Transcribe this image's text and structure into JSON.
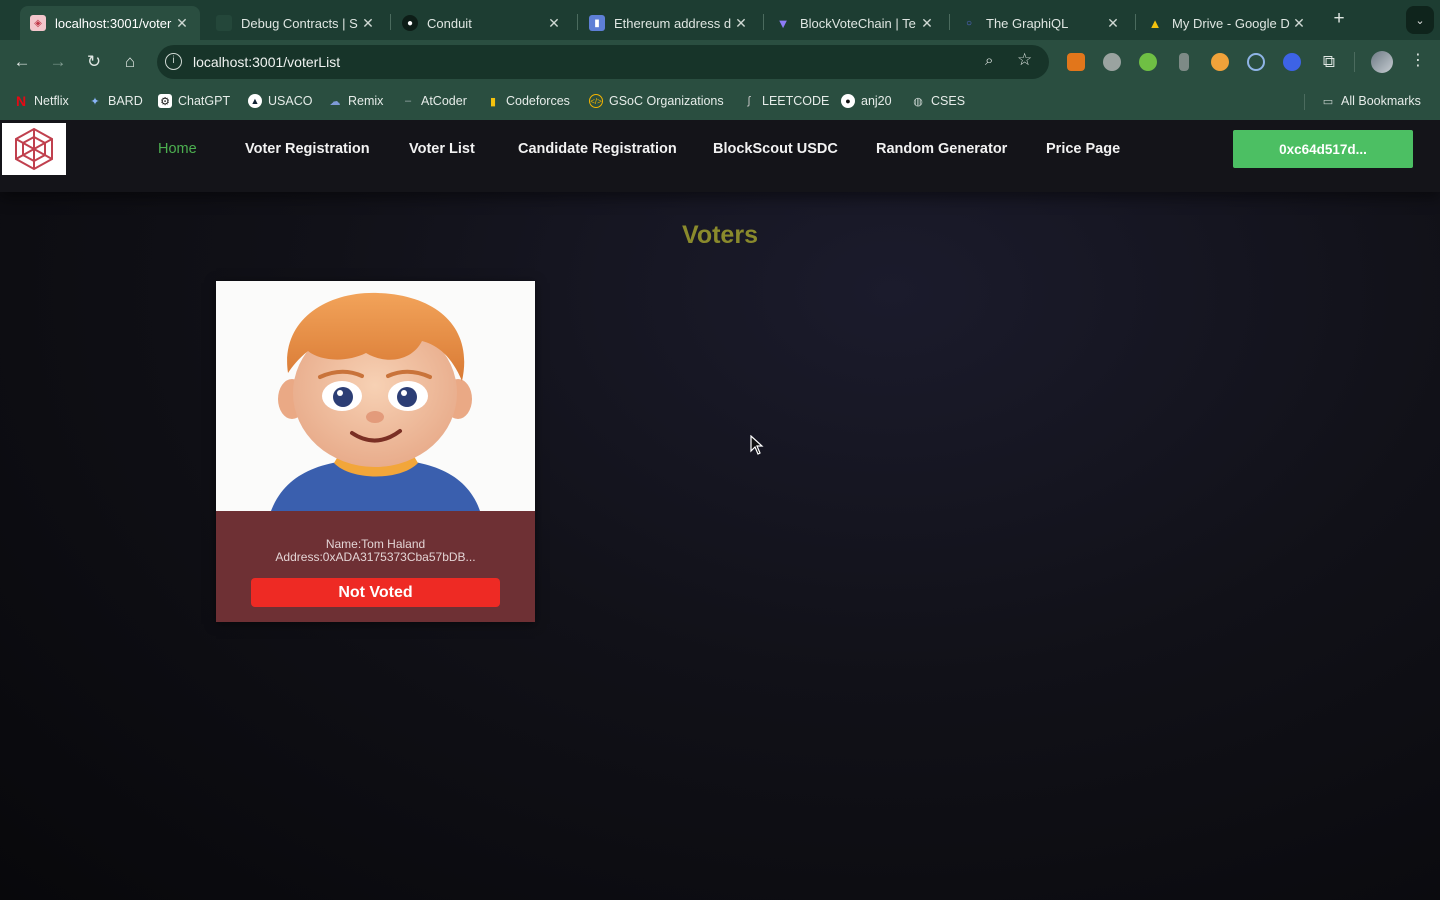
{
  "browser": {
    "tabs": [
      {
        "label": "localhost:3001/voter",
        "active": true,
        "closable": true
      },
      {
        "label": "Debug Contracts | S",
        "active": false,
        "closable": true
      },
      {
        "label": "Conduit",
        "active": false,
        "closable": true
      },
      {
        "label": "Ethereum address d",
        "active": false,
        "closable": true
      },
      {
        "label": "BlockVoteChain | Te",
        "active": false,
        "closable": true
      },
      {
        "label": "The GraphiQL",
        "active": false,
        "closable": true
      },
      {
        "label": "My Drive - Google D",
        "active": false,
        "closable": true
      }
    ],
    "url": "localhost:3001/voterList",
    "bookmarks": [
      "Netflix",
      "BARD",
      "ChatGPT",
      "USACO",
      "Remix",
      "AtCoder",
      "Codeforces",
      "GSoC Organizations",
      "LEETCODE",
      "anj20",
      "CSES"
    ],
    "all_bookmarks_label": "All Bookmarks",
    "icons": {
      "back": "arrow-left-icon",
      "forward": "arrow-right-icon",
      "reload": "reload-icon",
      "home": "home-icon",
      "site_info": "info-icon",
      "zoom": "magnifier-icon",
      "bookmark_star": "star-icon",
      "extensions": "puzzle-icon",
      "menu": "kebab-menu-icon"
    }
  },
  "site": {
    "nav": {
      "links": [
        "Home",
        "Voter Registration",
        "Voter List",
        "Candidate Registration",
        "BlockScout USDC",
        "Random Generator",
        "Price Page"
      ],
      "active_index": 0,
      "wallet_label": "0xc64d517d..."
    },
    "heading": "Voters",
    "voters": [
      {
        "name_text": "Name:Tom Haland",
        "address_text": "Address:0xADA3175373Cba57bDB...",
        "status_label": "Not Voted",
        "image": "cartoon-boy-avatar"
      }
    ],
    "colors": {
      "active_link": "#4caf50",
      "heading": "#8a8a2c",
      "wallet_button": "#4cbf63",
      "card_background": "#6e3034",
      "not_voted_button": "#ee2a24",
      "browser_chrome": "#2a4e40"
    }
  }
}
